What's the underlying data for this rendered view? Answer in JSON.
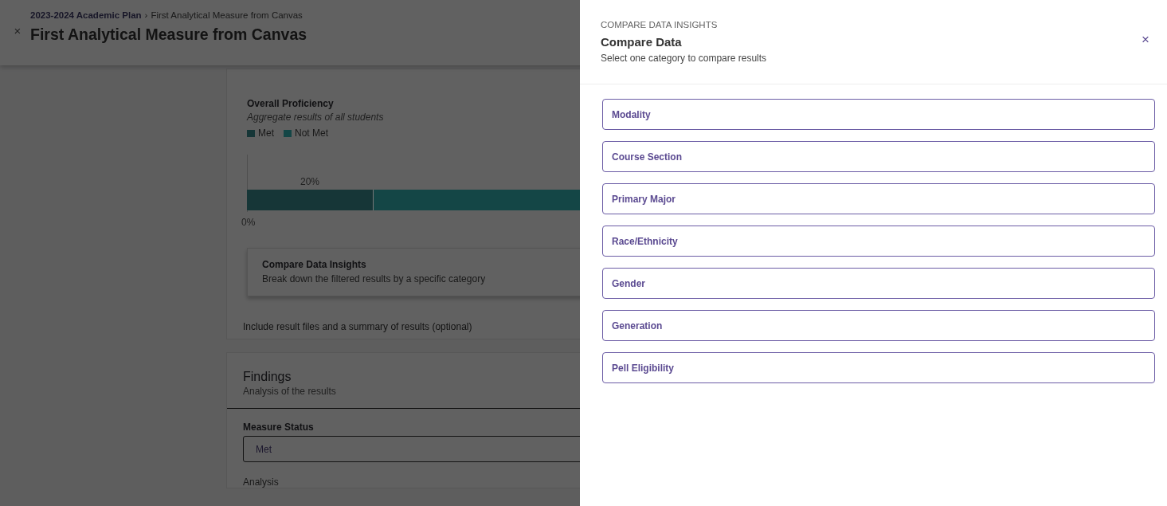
{
  "page": {
    "close": "×",
    "breadcrumb": {
      "parent": "2023-2024 Academic Plan",
      "separator": "›",
      "current": "First Analytical Measure from Canvas"
    },
    "title": "First Analytical Measure from Canvas"
  },
  "results": {
    "title": "Overall Proficiency",
    "subtitle": "Aggregate results of all students",
    "legend": [
      {
        "label": "Met",
        "color": "#163637"
      },
      {
        "label": "Not Met",
        "color": "#144646"
      }
    ],
    "bar": {
      "level": 0.2,
      "label": "20%",
      "axis_label": "0%"
    },
    "insights_card": {
      "title": "Compare Data Insights",
      "text": "Break down the filtered results by a specific category"
    },
    "files_note": "Include result files and a summary of results (optional)"
  },
  "findings": {
    "title": "Findings",
    "subtitle": "Analysis of the results",
    "status_label": "Measure Status",
    "status_value": "Met",
    "analysis_label": "Analysis"
  },
  "drawer": {
    "eyebrow": "COMPARE DATA INSIGHTS",
    "title": "Compare Data",
    "subtitle": "Select one category to compare results",
    "close": "×",
    "categories": [
      "Modality",
      "Course Section",
      "Primary Major",
      "Race/Ethnicity",
      "Gender",
      "Generation",
      "Pell Eligibility"
    ]
  }
}
